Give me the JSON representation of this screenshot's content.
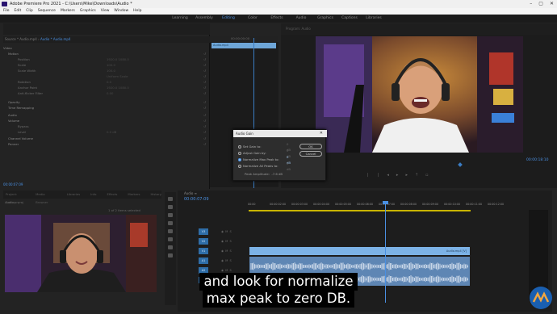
{
  "window": {
    "title": "Adobe Premiere Pro 2021 - C:\\Users\\Mike\\Downloads\\Audio *",
    "controls": [
      "–",
      "▢",
      "✕"
    ]
  },
  "menu": [
    "File",
    "Edit",
    "Clip",
    "Sequence",
    "Markers",
    "Graphics",
    "View",
    "Window",
    "Help"
  ],
  "workspaces": {
    "tabs": [
      "Learning",
      "Assembly",
      "Editing",
      "Color",
      "Effects",
      "Audio",
      "Graphics",
      "Captions",
      "Libraries"
    ],
    "active_index": 2
  },
  "effect_controls": {
    "clip_source": "Source * Audio.mp4",
    "clip_selected": "Audio * Audio.mp4",
    "section_video": "Video",
    "rows": [
      {
        "label": "Motion",
        "value": "",
        "section": true
      },
      {
        "label": "Position",
        "value": "1920.0   1080.0"
      },
      {
        "label": "Scale",
        "value": "100.0"
      },
      {
        "label": "Scale Width",
        "value": "100.0"
      },
      {
        "label": "",
        "value": "Uniform Scale"
      },
      {
        "label": "Rotation",
        "value": "0.0"
      },
      {
        "label": "Anchor Point",
        "value": "1920.0   1080.0"
      },
      {
        "label": "Anti-flicker Filter",
        "value": "0.00"
      },
      {
        "label": "Opacity",
        "value": "",
        "section": true
      },
      {
        "label": "Time Remapping",
        "value": "",
        "section": true
      },
      {
        "label": "Audio",
        "value": "",
        "section": true
      },
      {
        "label": "Volume",
        "value": "",
        "section": true
      },
      {
        "label": "Bypass",
        "value": ""
      },
      {
        "label": "Level",
        "value": "0.0 dB"
      },
      {
        "label": "Channel Volume",
        "value": "",
        "section": true
      },
      {
        "label": "Panner",
        "value": "",
        "section": true
      }
    ],
    "timeline_time": "00:00:00:00",
    "clip_name": "Audio.mp4",
    "footer_time": "00:00:07:09"
  },
  "program": {
    "title": "Program: Audio",
    "timecode": "00:00:18:10"
  },
  "dialog": {
    "title": "Audio Gain",
    "close": "✕",
    "options": [
      {
        "label": "Set Gain to:",
        "value": "0 dB",
        "selected": false
      },
      {
        "label": "Adjust Gain by:",
        "value": "0 dB",
        "selected": false
      },
      {
        "label": "Normalize Max Peak to:",
        "value": "0 dB",
        "selected": true
      },
      {
        "label": "Normalize All Peaks to:",
        "value": "0 dB",
        "selected": false
      }
    ],
    "peak_label": "Peak Amplitude:",
    "peak_value": "-7.6 dB",
    "ok": "OK",
    "cancel": "Cancel"
  },
  "project": {
    "tabs": [
      "Project: Audio",
      "Media Browser",
      "Libraries",
      "Info",
      "Effects",
      "Markers",
      "History"
    ],
    "name": "Audio.prproj",
    "items": "1 of 2 items selected"
  },
  "timeline": {
    "tab": "Audio",
    "timecode": "00:00:07:09",
    "ruler": [
      "00:00",
      "00:00:02:00",
      "00:00:03:00",
      "00:00:04:00",
      "00:00:05:00",
      "00:00:06:00",
      "00:00:07:00",
      "00:00:08:00",
      "00:00:09:00",
      "00:00:10:00",
      "00:00:11:00",
      "00:00:12:00"
    ],
    "tracks": [
      "V3",
      "V2",
      "V1",
      "A1",
      "A2",
      "A3"
    ],
    "v1_clip": "Audio.mp4 [V]"
  },
  "subtitles": {
    "line1": "and look for normalize",
    "line2": "max peak to zero DB."
  }
}
